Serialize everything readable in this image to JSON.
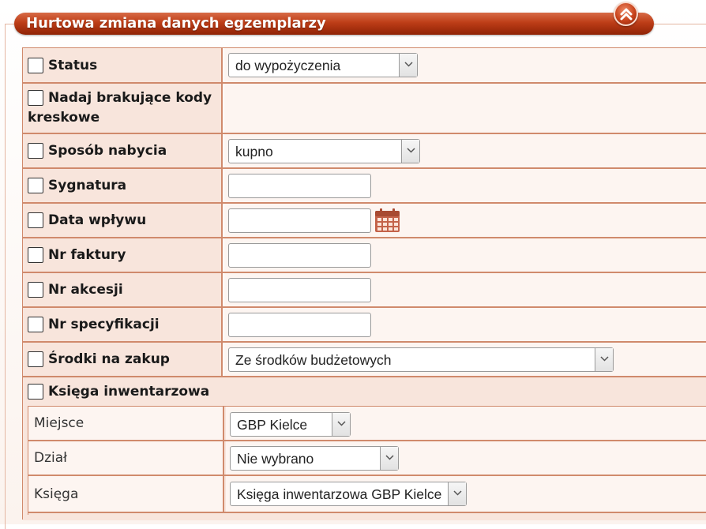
{
  "header": {
    "title": "Hurtowa zmiana danych egzemplarzy"
  },
  "colors": {
    "accent": "#bd3d17",
    "label_bg": "#f8e5dc",
    "border": "#d08a6c"
  },
  "icons": {
    "collapse": "chevron-up-double-icon",
    "calendar": "calendar-icon",
    "dropdown": "chevron-down-icon"
  },
  "fields": {
    "status": {
      "label": "Status",
      "value": "do wypożyczenia",
      "checked": false
    },
    "barcodes": {
      "label_line1": "Nadaj brakujące kody",
      "label_line2": "kreskowe",
      "checked": false
    },
    "acquisition": {
      "label": "Sposób nabycia",
      "value": "kupno",
      "checked": false
    },
    "signature": {
      "label": "Sygnatura",
      "value": "",
      "checked": false
    },
    "date_received": {
      "label": "Data wpływu",
      "value": "",
      "checked": false
    },
    "invoice_no": {
      "label": "Nr faktury",
      "value": "",
      "checked": false
    },
    "accession_no": {
      "label": "Nr akcesji",
      "value": "",
      "checked": false
    },
    "spec_no": {
      "label": "Nr specyfikacji",
      "value": "",
      "checked": false
    },
    "funds": {
      "label": "Środki na zakup",
      "value": "Ze środków budżetowych",
      "checked": false
    },
    "inventory_book": {
      "label": "Księga inwentarzowa",
      "checked": false,
      "place": {
        "label": "Miejsce",
        "value": "GBP Kielce"
      },
      "department": {
        "label": "Dział",
        "value": "Nie wybrano"
      },
      "book": {
        "label": "Księga",
        "value": "Księga inwentarzowa GBP Kielce"
      }
    }
  }
}
